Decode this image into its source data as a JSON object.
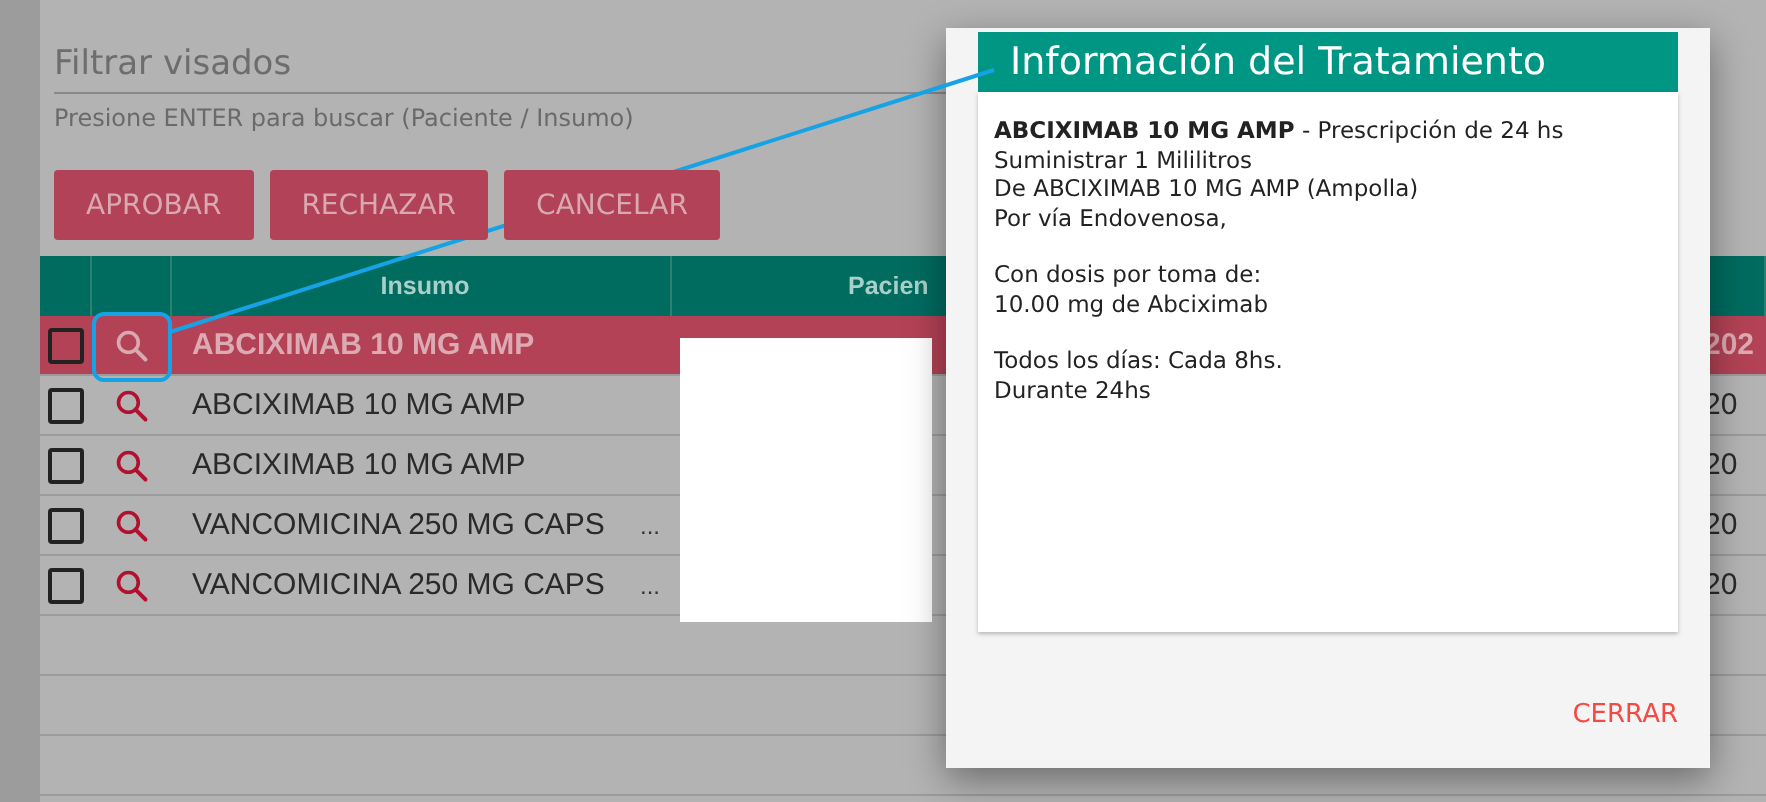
{
  "filter": {
    "placeholder": "Filtrar visados",
    "hint": "Presione ENTER para buscar (Paciente / Insumo)"
  },
  "actions": [
    "APROBAR",
    "RECHAZAR",
    "CANCELAR"
  ],
  "table": {
    "columns": [
      {
        "label": "Insumo"
      },
      {
        "label": "Pacien"
      }
    ],
    "rows": [
      {
        "selected": true,
        "checked": false,
        "insumo": "ABCIXIMAB 10 MG AMP",
        "column_5": "202"
      },
      {
        "selected": false,
        "checked": false,
        "insumo": "ABCIXIMAB 10 MG AMP",
        "column_5": "20"
      },
      {
        "selected": false,
        "checked": false,
        "insumo": "ABCIXIMAB 10 MG AMP",
        "column_5": "20"
      },
      {
        "selected": false,
        "checked": false,
        "insumo": "VANCOMICINA 250 MG CAPS",
        "more": "...",
        "column_5": "20"
      },
      {
        "selected": false,
        "checked": false,
        "insumo": "VANCOMICINA 250 MG CAPS",
        "more": "...",
        "column_5": "20"
      }
    ]
  },
  "modal": {
    "title": "Información del Tratamiento",
    "paragraphs": [
      [
        "**ABCIXIMAB 10 MG AMP** - Prescripción de 24 hs",
        "Suministrar 1 Mililitros",
        "De ABCIXIMAB 10 MG AMP (Ampolla)",
        "Por vía Endovenosa,"
      ],
      [
        "Con dosis por toma de:",
        "10.00 mg de Abciximab"
      ],
      [
        "Todos los días: Cada 8hs.",
        "Durante 24hs"
      ]
    ],
    "close_button": "CERRAR"
  }
}
